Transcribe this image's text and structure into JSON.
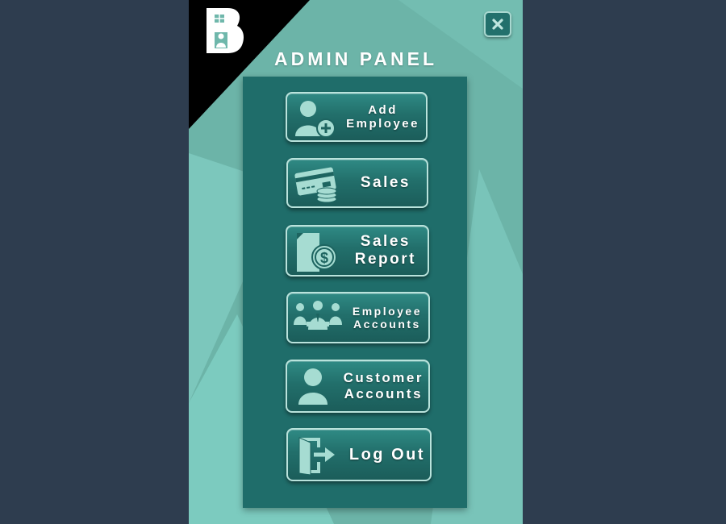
{
  "title": "ADMIN PANEL",
  "logo_letter": "B",
  "menu": [
    {
      "lines": [
        "Add",
        "Employee"
      ],
      "icon": "add-user-icon"
    },
    {
      "lines": [
        "Sales"
      ],
      "icon": "credit-card-coins-icon"
    },
    {
      "lines": [
        "Sales",
        "Report"
      ],
      "icon": "dollar-report-icon"
    },
    {
      "lines": [
        "Employee",
        "Accounts"
      ],
      "icon": "team-icon"
    },
    {
      "lines": [
        "Customer",
        "Accounts"
      ],
      "icon": "customer-icon"
    },
    {
      "lines": [
        "Log Out"
      ],
      "icon": "exit-door-icon"
    }
  ],
  "colors": {
    "page_bg": "#2e3d4f",
    "app_bg": "#6fb7ab",
    "panel_bg": "#1f6d6a",
    "icon_fill": "#a6dcd2"
  }
}
